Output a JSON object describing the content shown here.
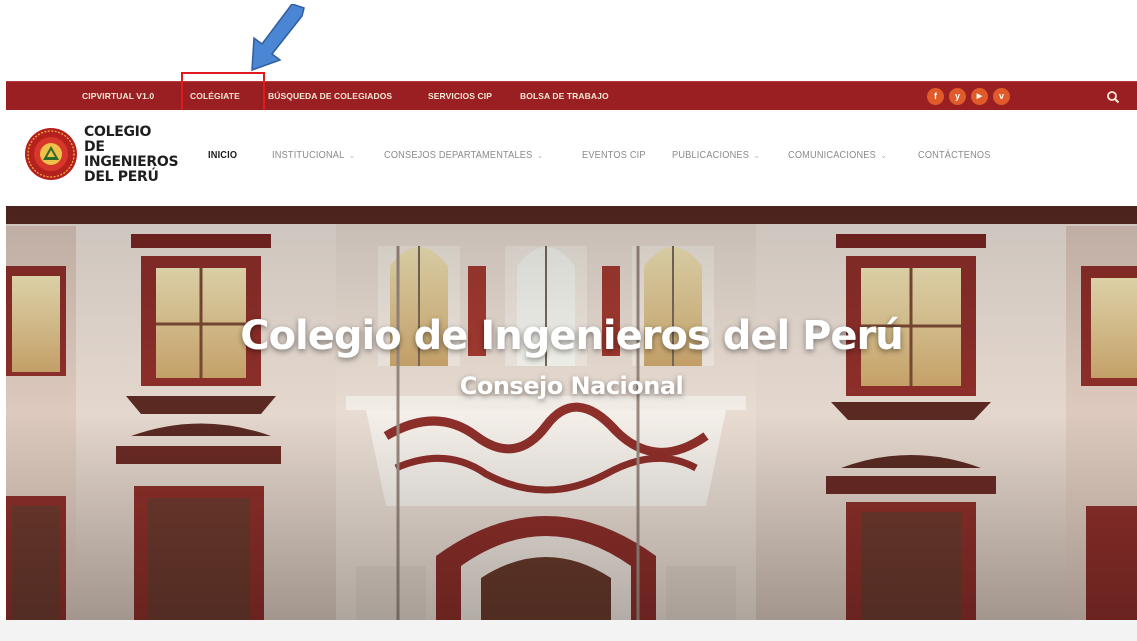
{
  "annotation": {
    "arrow_color": "#4a86d4",
    "box_color": "#e01b1b"
  },
  "topbar": {
    "background": "#9a1f22",
    "links": [
      "CIPVIRTUAL V1.0",
      "COLÉGIATE",
      "BÚSQUEDA DE COLEGIADOS",
      "SERVICIOS CIP",
      "BOLSA DE TRABAJO"
    ],
    "social": [
      {
        "icon": "facebook-icon",
        "glyph": "f"
      },
      {
        "icon": "twitter-icon",
        "glyph": "y"
      },
      {
        "icon": "youtube-icon",
        "glyph": "▶"
      },
      {
        "icon": "vimeo-icon",
        "glyph": "v"
      }
    ],
    "search_icon": "search-icon"
  },
  "logo": {
    "line1": "COLEGIO DE",
    "line2": "INGENIEROS",
    "line3": "DEL PERÚ"
  },
  "nav": [
    {
      "label": "INICIO"
    },
    {
      "label": "INSTITUCIONAL",
      "chevron": "⌄"
    },
    {
      "label": "CONSEJOS DEPARTAMENTALES",
      "chevron": "⌄"
    },
    {
      "label": "EVENTOS CIP"
    },
    {
      "label": "PUBLICACIONES",
      "chevron": "⌄"
    },
    {
      "label": "COMUNICACIONES",
      "chevron": "⌄"
    },
    {
      "label": "CONTÁCTENOS"
    }
  ],
  "hero": {
    "title": "Colegio de Ingenieros del Perú",
    "subtitle": "Consejo Nacional"
  }
}
